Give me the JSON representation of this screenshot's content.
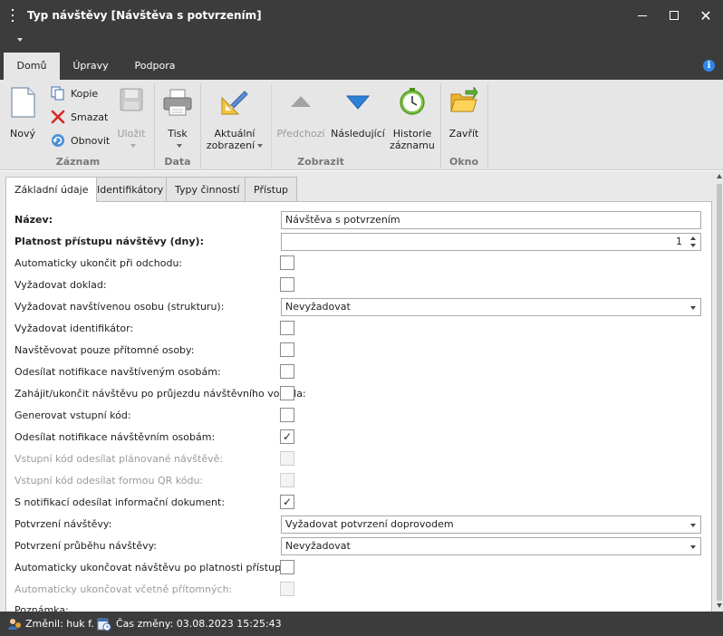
{
  "window": {
    "title": "Typ návštěvy [Návštěva s potvrzením]",
    "minimize": "",
    "maximize": "",
    "close": "✕"
  },
  "ribbon_tabs": [
    "Domů",
    "Úpravy",
    "Podpora"
  ],
  "ribbon": {
    "zaznam": {
      "group": "Záznam",
      "novy": "Nový",
      "kopie": "Kopie",
      "smazat": "Smazat",
      "obnovit": "Obnovit",
      "ulozit": "Uložit"
    },
    "data": {
      "group": "Data",
      "tisk": "Tisk"
    },
    "zobrazit": {
      "group": "Zobrazit",
      "aktualni_1": "Aktuální",
      "aktualni_2": "zobrazení",
      "predchozi": "Předchozí",
      "nasledujici": "Následující",
      "historie_1": "Historie",
      "historie_2": "záznamu"
    },
    "okno": {
      "group": "Okno",
      "zavrit": "Zavřít"
    }
  },
  "content_tabs": [
    "Základní údaje",
    "Identifikátory",
    "Typy činností",
    "Přístup"
  ],
  "form": {
    "nazev_label": "Název:",
    "nazev_value": "Návštěva s potvrzením",
    "platnost_label": "Platnost přístupu návštěvy (dny):",
    "platnost_value": "1",
    "auto_ukoncit_label": "Automaticky ukončit při odchodu:",
    "vyzadovat_doklad_label": "Vyžadovat doklad:",
    "vyzadovat_osobu_label": "Vyžadovat navštívenou osobu (strukturu):",
    "vyzadovat_osobu_value": "Nevyžadovat",
    "vyzadovat_ident_label": "Vyžadovat identifikátor:",
    "navstevovat_label": "Navštěvovat pouze přítomné osoby:",
    "odesilat_notif_label": "Odesílat notifikace navštíveným osobám:",
    "zahajit_label": "Zahájit/ukončit návštěvu po průjezdu návštěvního vozidla:",
    "generovat_label": "Generovat vstupní kód:",
    "odeslat_notif_label": "Odesílat notifikace návštěvním osobám:",
    "odeslat_notif_mark": "✓",
    "vstupni_plan_label": "Vstupní kód odesílat plánované návštěvě:",
    "vstupni_qr_label": "Vstupní kód odesílat formou QR kódu:",
    "s_notifikaci_label": "S notifikací odesílat informační dokument:",
    "s_notifikaci_mark": "✓",
    "potvrzeni_label": "Potvrzení návštěvy:",
    "potvrzeni_value": "Vyžadovat potvrzení doprovodem",
    "potvrzeni_prubehu_label": "Potvrzení průběhu návštěvy:",
    "potvrzeni_prubehu_value": "Nevyžadovat",
    "auto_ukoncovat_label": "Automaticky ukončovat návštěvu po platnosti přístupu:",
    "auto_vcetne_label": "Automaticky ukončovat včetně přítomných:",
    "poznamka_label": "Poznámka:"
  },
  "status": {
    "zmenil": "Změnil: huk f.",
    "cas": "Čas změny: 03.08.2023 15:25:43"
  }
}
